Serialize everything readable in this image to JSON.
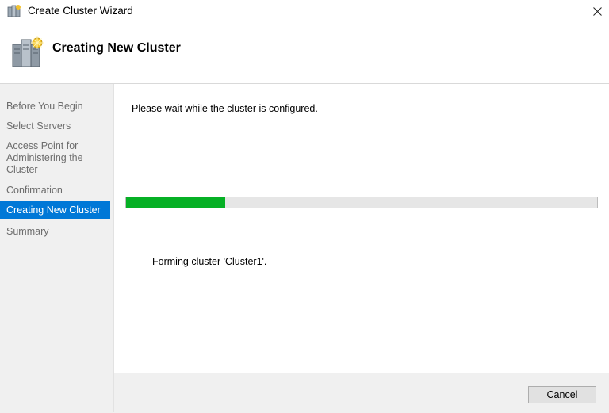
{
  "window": {
    "title": "Create Cluster Wizard",
    "app_icon": "cluster-icon",
    "close_icon": "close-icon"
  },
  "header": {
    "title": "Creating New Cluster",
    "icon": "cluster-servers-icon"
  },
  "sidebar": {
    "steps": [
      {
        "label": "Before You Begin",
        "active": false
      },
      {
        "label": "Select Servers",
        "active": false
      },
      {
        "label": "Access Point for Administering the Cluster",
        "active": false
      },
      {
        "label": "Confirmation",
        "active": false
      },
      {
        "label": "Creating New Cluster",
        "active": true
      },
      {
        "label": "Summary",
        "active": false
      }
    ]
  },
  "main": {
    "instruction": "Please wait while the cluster is configured.",
    "progress_fraction": 0.21,
    "status_text": "Forming cluster 'Cluster1'."
  },
  "footer": {
    "cancel_label": "Cancel"
  },
  "colors": {
    "progress_fill": "#06b025",
    "active_step": "#0078d7"
  }
}
